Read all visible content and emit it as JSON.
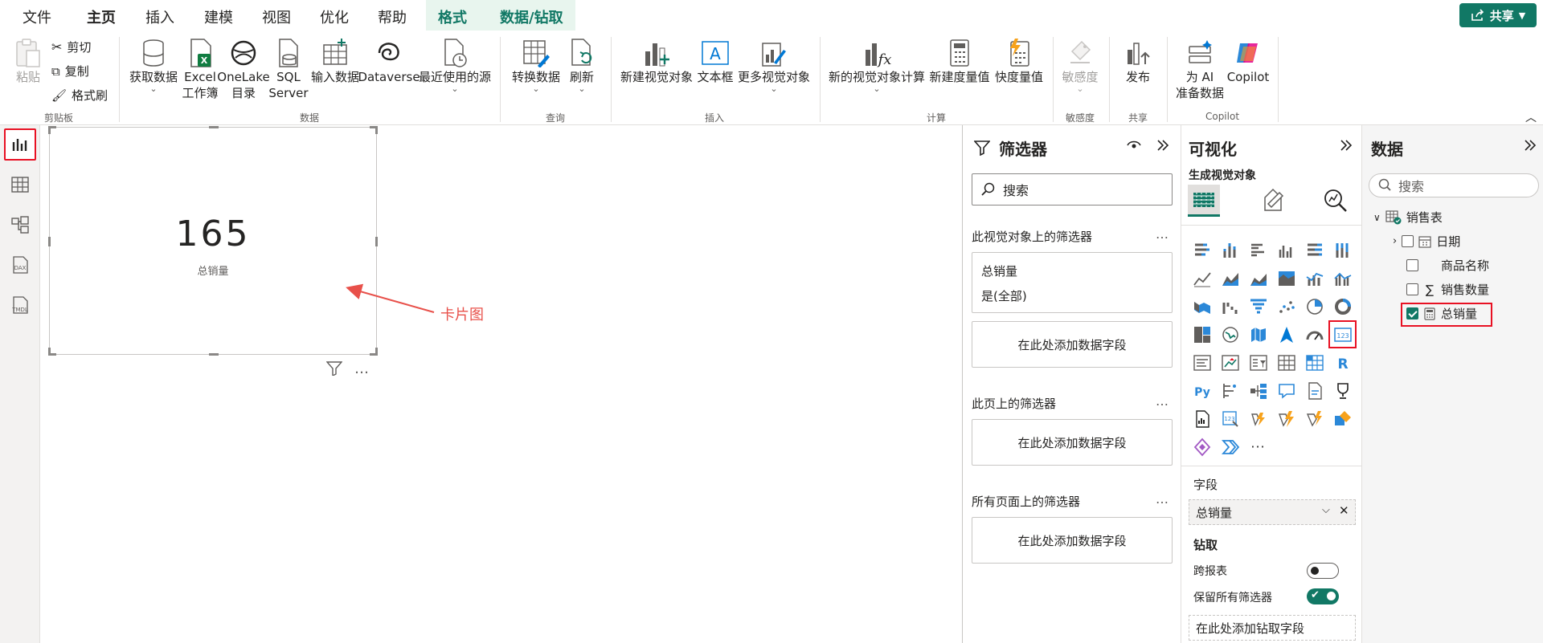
{
  "menu": {
    "tabs": [
      "文件",
      "主页",
      "插入",
      "建模",
      "视图",
      "优化",
      "帮助"
    ],
    "contextual_tabs": [
      "格式",
      "数据/钻取"
    ],
    "share_label": "共享"
  },
  "ribbon": {
    "clipboard": {
      "paste": "粘贴",
      "cut": "剪切",
      "copy": "复制",
      "format_painter": "格式刷",
      "group": "剪贴板"
    },
    "data": {
      "get_data": "获取数据",
      "excel_1": "Excel",
      "excel_2": "工作簿",
      "onelake_1": "OneLake",
      "onelake_2": "目录",
      "sql_1": "SQL",
      "sql_2": "Server",
      "enter_data": "输入数据",
      "dataverse": "Dataverse",
      "recent": "最近使用的源",
      "group": "数据"
    },
    "query": {
      "transform": "转换数据",
      "refresh": "刷新",
      "group": "查询"
    },
    "insert": {
      "new_visual": "新建视觉对象",
      "text_box": "文本框",
      "more_visuals": "更多视觉对象",
      "group": "插入"
    },
    "calc": {
      "new_visual_calc": "新的视觉对象计算",
      "new_measure": "新建度量值",
      "quick_measure": "快度量值",
      "group": "计算"
    },
    "sensitivity": {
      "label": "敏感度",
      "group": "敏感度"
    },
    "share": {
      "publish": "发布",
      "group": "共享"
    },
    "copilot": {
      "ai_prep_1": "为 AI",
      "ai_prep_2": "准备数据",
      "copilot": "Copilot",
      "group": "Copilot"
    }
  },
  "left_rail": {
    "items": [
      "report-view",
      "table-view",
      "model-view",
      "dax-query-view",
      "tmdl-view"
    ],
    "dax": "DAX",
    "tmdl": "TMDL"
  },
  "canvas": {
    "card_value": "165",
    "card_label": "总销量",
    "annotation": "卡片图"
  },
  "filters": {
    "title": "筛选器",
    "search_placeholder": "搜索",
    "on_visual": "此视觉对象上的筛选器",
    "card_field": "总销量",
    "card_condition": "是(全部)",
    "add_field": "在此处添加数据字段",
    "on_page": "此页上的筛选器",
    "on_all_pages": "所有页面上的筛选器",
    "more": "…"
  },
  "visualizations": {
    "title": "可视化",
    "build_visual": "生成视觉对象",
    "fields_label": "字段",
    "field_value": "总销量",
    "drill_label": "钻取",
    "cross_report": "跨报表",
    "cross_report_on": false,
    "keep_filters": "保留所有筛选器",
    "keep_filters_on": true,
    "add_drill_field": "在此处添加钻取字段",
    "more_visuals": "···"
  },
  "data_pane": {
    "title": "数据",
    "search_placeholder": "搜索",
    "table_name": "销售表",
    "fields": [
      {
        "name": "日期",
        "checked": false
      },
      {
        "name": "商品名称",
        "checked": false
      },
      {
        "name": "销售数量",
        "checked": false
      },
      {
        "name": "总销量",
        "checked": true
      }
    ]
  },
  "colors": {
    "accent": "#117865",
    "highlight": "#e81123",
    "annotation": "#e8504a"
  }
}
